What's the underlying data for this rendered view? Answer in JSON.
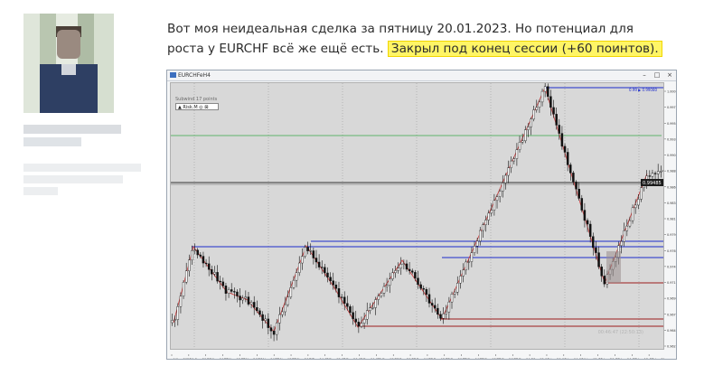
{
  "post": {
    "text": "Вот моя неидеальная сделка за пятницу 20.01.2023. Но потенциал для роста у EURCHF всё же ещё есть.",
    "highlight": "Закрыл под конец сессии (+60 поинтов)."
  },
  "window": {
    "title": "EURCHFeH4",
    "minimize": "–",
    "maximize": "□",
    "close": "×"
  },
  "chart": {
    "indicator_label": "Subwind 17 points",
    "indicator_name": "▲ Risk.M ◎ ⊠",
    "watermark": "00:46:47 (22:50:13)",
    "price_tag": "0.99485",
    "top_right_label": "0.99 ▶ 0.99080"
  },
  "chart_data": {
    "type": "candlestick",
    "symbol": "EURCHF",
    "timeframe": "H4",
    "x_ticks": [
      "4 Nov 2022",
      "10 Nov 20:00",
      "14 Nov 04:00",
      "17 Nov 12:00",
      "18 Nov 20:00",
      "24 Nov 04:00",
      "25 Nov 12:00",
      "29 Nov 20:00",
      "2 Dec 04:00",
      "6 Dec 12:00",
      "7 Dec 20:00",
      "9 Dec 04:00",
      "13 Dec 12:00",
      "14 Dec 20:00",
      "16 Dec 04:00",
      "20 Dec 12:00",
      "21 Dec 20:00",
      "23 Dec 04:00",
      "27 Dec 12:00",
      "28 Dec 20:00",
      "30 Dec 04:00",
      "4 Jan 12:00",
      "5 Jan 20:00",
      "9 Jan 04:00",
      "11 Jan 12:00",
      "12 Jan 20:00",
      "16 Jan 04:00",
      "17 Jan 12:00",
      "18 Jan 20:00"
    ],
    "y_ticks": [
      "1.00050",
      "0.99780",
      "0.99540",
      "0.99310",
      "0.99070",
      "0.98840",
      "0.98600",
      "0.98370",
      "0.98130",
      "0.97900",
      "0.97660",
      "0.97430",
      "0.97190",
      "0.96960",
      "0.96720",
      "0.96490",
      "0.96250"
    ],
    "ylim": [
      0.9615,
      1.0015
    ]
  }
}
